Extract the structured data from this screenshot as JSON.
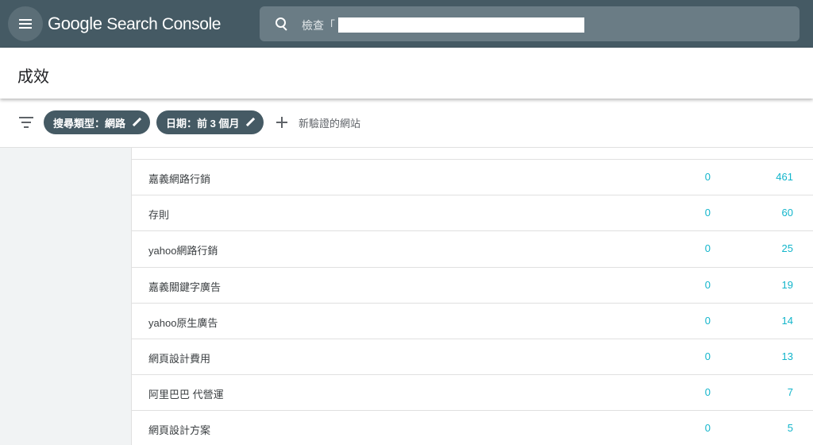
{
  "appbar": {
    "logo_brand": "Google",
    "logo_product": "Search Console",
    "search": {
      "placeholder": "檢查「",
      "value": ""
    }
  },
  "page": {
    "title": "成效"
  },
  "filters": {
    "chips": [
      {
        "label": "搜尋類型：網路"
      },
      {
        "label": "日期：前 3 個月"
      }
    ],
    "add_label": "新驗證的網站"
  },
  "table": {
    "rows": [
      {
        "query": "嘉義網路行銷",
        "clicks": "0",
        "impressions": "461"
      },
      {
        "query": "存則",
        "clicks": "0",
        "impressions": "60"
      },
      {
        "query": "yahoo網路行銷",
        "clicks": "0",
        "impressions": "25"
      },
      {
        "query": "嘉義關鍵字廣告",
        "clicks": "0",
        "impressions": "19"
      },
      {
        "query": "yahoo原生廣告",
        "clicks": "0",
        "impressions": "14"
      },
      {
        "query": "網頁設計費用",
        "clicks": "0",
        "impressions": "13"
      },
      {
        "query": "阿里巴巴 代營運",
        "clicks": "0",
        "impressions": "7"
      },
      {
        "query": "網頁設計方案",
        "clicks": "0",
        "impressions": "5"
      }
    ]
  },
  "colors": {
    "appbar": "#455a64",
    "search_field": "#6a7c85",
    "chip": "#455a64",
    "metric": "#12b5cb"
  },
  "icons": [
    "menu-icon",
    "search-icon",
    "filter-icon",
    "edit-icon",
    "plus-icon"
  ]
}
